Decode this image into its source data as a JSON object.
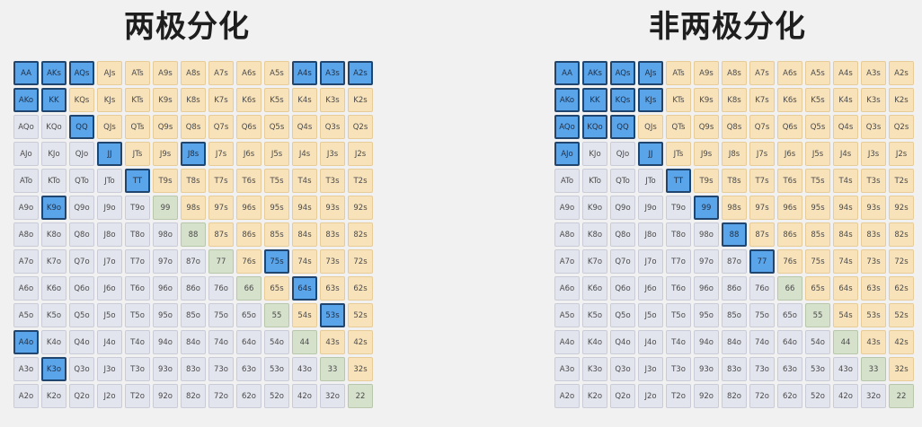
{
  "titles": {
    "left": "两极分化",
    "right": "非两极分化"
  },
  "colors": {
    "suited": "#f8e2b9",
    "offsuit": "#e3e5ee",
    "pair": "#d6e1cc",
    "selected": "#5aa4ea"
  },
  "ranks": [
    "A",
    "K",
    "Q",
    "J",
    "T",
    "9",
    "8",
    "7",
    "6",
    "5",
    "4",
    "3",
    "2"
  ],
  "left_selected": [
    "AA",
    "AKs",
    "AQs",
    "A4s",
    "A3s",
    "A2s",
    "AKo",
    "KK",
    "QQ",
    "JJ",
    "J8s",
    "TT",
    "K9o",
    "75s",
    "64s",
    "53s",
    "A4o",
    "K3o"
  ],
  "right_selected": [
    "AA",
    "AKs",
    "AQs",
    "AJs",
    "AKo",
    "KK",
    "KQs",
    "KJs",
    "AQo",
    "KQo",
    "QQ",
    "AJo",
    "JJ",
    "TT",
    "99",
    "88",
    "77"
  ]
}
